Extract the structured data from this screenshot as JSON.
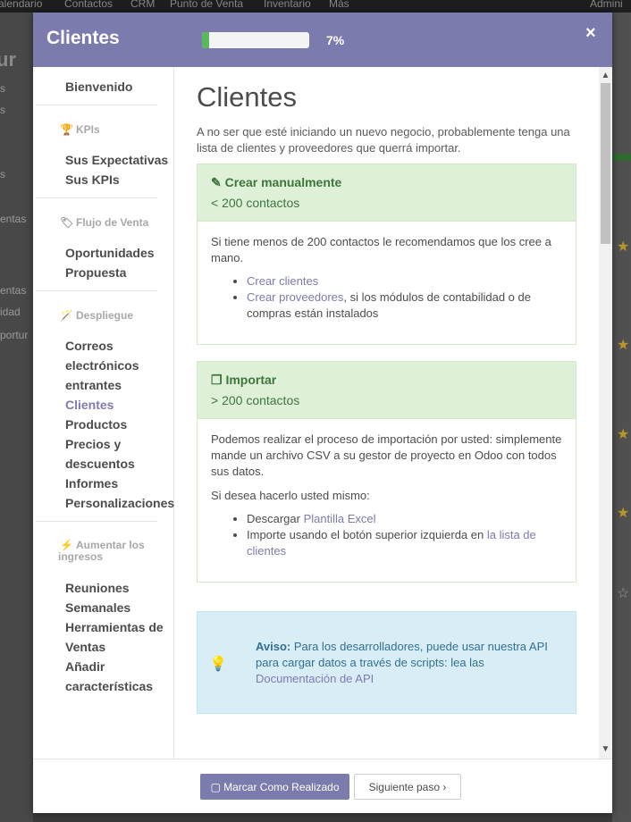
{
  "background": {
    "topbar": [
      "alendario",
      "Contactos",
      "CRM",
      "Punto de Venta",
      "Inventario",
      "Más",
      "Admini"
    ],
    "left_title": "ur",
    "left_items": [
      "s",
      "s",
      "s",
      "entas",
      "entas",
      "idad",
      "portur"
    ]
  },
  "modal": {
    "title": "Clientes",
    "progress_percent": 7,
    "progress_text": "7%",
    "close_glyph": "×"
  },
  "sidebar": {
    "welcome": "Bienvenido",
    "cat_kpis": "KPIs",
    "kpi_items": [
      "Sus Expectativas",
      "Sus KPIs"
    ],
    "cat_flujo": "Flujo de Venta",
    "flujo_items": [
      "Oportunidades",
      "Propuesta"
    ],
    "cat_despliegue": "Despliegue",
    "despliegue_items": [
      "Correos",
      "electrónicos",
      "entrantes",
      "Clientes",
      "Productos",
      "Precios y",
      "descuentos",
      "Informes",
      "Personalizaciones"
    ],
    "cat_aumentar_1": "Aumentar los",
    "cat_aumentar_2": "ingresos",
    "aumentar_items": [
      "Reuniones",
      "Semanales",
      "Herramientas de",
      "Ventas",
      "Añadir",
      "características"
    ]
  },
  "content": {
    "title": "Clientes",
    "intro": "A no ser que esté iniciando un nuevo negocio, probablemente tenga una lista de clientes y proveedores que querrá importar.",
    "manual": {
      "heading": "Crear manualmente",
      "sub": "< 200 contactos",
      "text": "Si tiene menos de 200 contactos le recomendamos que los cree a mano.",
      "link1": "Crear clientes",
      "link2": "Crear proveedores",
      "link2_suffix": ", si los módulos de contabilidad o de compras están instalados"
    },
    "import": {
      "heading": "Importar",
      "sub": "> 200 contactos",
      "text1": "Podemos realizar el proceso de importación por usted: simplemente mande un archivo CSV a su gestor de proyecto en Odoo con todos sus datos.",
      "text2": "Si desea hacerlo usted mismo:",
      "item1_prefix": "Descargar ",
      "item1_link": "Plantilla Excel",
      "item2_prefix": "Importe usando el botón superior izquierda en ",
      "item2_link": "la lista de clientes"
    },
    "notice": {
      "label": "Aviso:",
      "text": " Para los desarrolladores, puede usar nuestra API para cargar datos a través de scripts: lea las ",
      "link": "Documentación de API"
    }
  },
  "footer": {
    "done_label": "Marcar Como Realizado",
    "next_label": "Siguiente paso"
  },
  "colors": {
    "brand": "#7c7bad",
    "progress": "#5cb85c"
  }
}
